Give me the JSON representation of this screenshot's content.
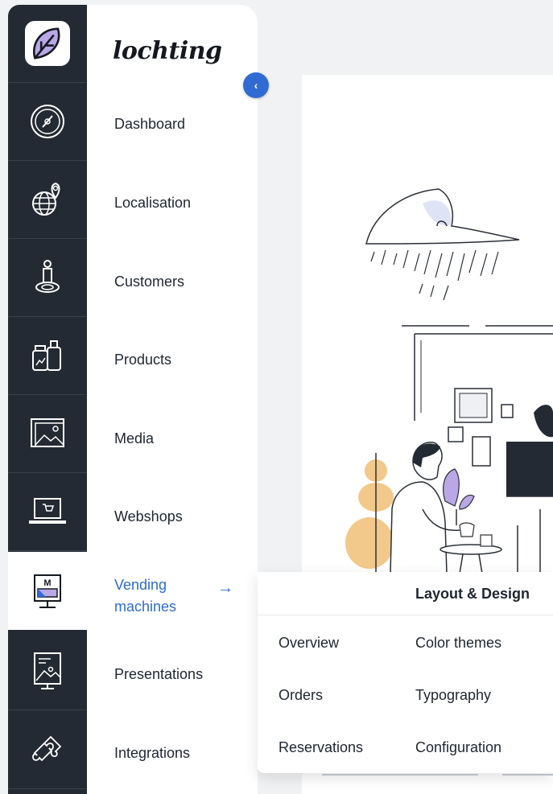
{
  "brand": {
    "name": "lochting"
  },
  "rail": {
    "items": [
      {
        "icon": "leaf-logo-icon"
      },
      {
        "icon": "dashboard-gauge-icon"
      },
      {
        "icon": "globe-pin-icon"
      },
      {
        "icon": "person-pin-icon"
      },
      {
        "icon": "products-bottles-icon"
      },
      {
        "icon": "media-image-icon"
      },
      {
        "icon": "laptop-cart-icon"
      },
      {
        "icon": "vending-monitor-icon",
        "active": true
      },
      {
        "icon": "presentation-board-icon"
      },
      {
        "icon": "puzzle-icon"
      }
    ]
  },
  "menu": {
    "items": [
      {
        "label": "Dashboard"
      },
      {
        "label": "Localisation"
      },
      {
        "label": "Customers"
      },
      {
        "label": "Products"
      },
      {
        "label": "Media"
      },
      {
        "label": "Webshops"
      },
      {
        "label": "Vending machines",
        "active": true
      },
      {
        "label": "Presentations"
      },
      {
        "label": "Integrations"
      }
    ],
    "active_arrow": "→",
    "collapse_glyph": "‹"
  },
  "submenu": {
    "title": "Layout & Design",
    "left": [
      "Overview",
      "Orders",
      "Reservations"
    ],
    "right": [
      "Color themes",
      "Typography",
      "Configuration"
    ]
  },
  "colors": {
    "rail_bg": "#242a33",
    "accent": "#2f6bd3",
    "purple": "#b9a7e6",
    "yellow": "#f2c98a"
  }
}
